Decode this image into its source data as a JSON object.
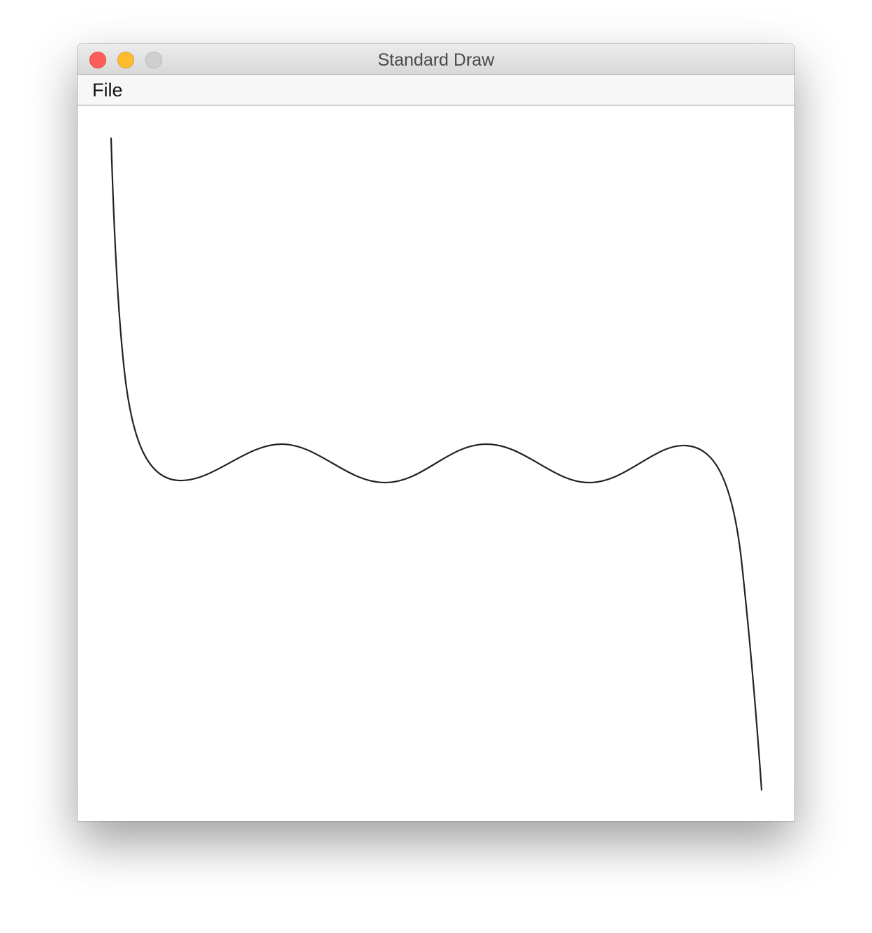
{
  "window": {
    "title": "Standard Draw",
    "traffic_lights": {
      "close": "#fc5f57",
      "minimize": "#fdbc2e",
      "zoom": "#cfcfcf"
    }
  },
  "menubar": {
    "items": [
      {
        "label": "File"
      }
    ]
  },
  "canvas": {
    "background": "#ffffff",
    "stroke_color": "#222222"
  }
}
